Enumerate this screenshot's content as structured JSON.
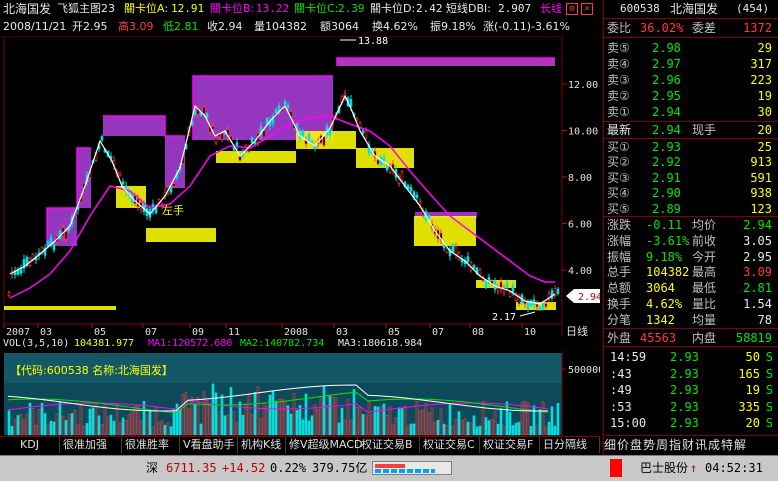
{
  "header": {
    "stock_name": "北海国发",
    "indicator_name": "飞狐主图23",
    "pass_a_label": "關卡位A:",
    "pass_a_value": "12.91",
    "pass_b_label": "關卡位B:",
    "pass_b_value": "13.22",
    "pass_c_label": "關卡位C:",
    "pass_c_value": "2.39",
    "pass_d_label": "關卡位D:",
    "pass_d_value": "2.42",
    "dbi_label": "短线DBI:",
    "dbi_value": "2.907",
    "trend_label": "长线"
  },
  "info_bar": {
    "date": "2008/11/21",
    "open": "开2.95",
    "high": "高3.09",
    "low": "低2.81",
    "close": "收2.94",
    "volume": "量104382",
    "amount": "额3064",
    "turnover": "换4.62%",
    "amplitude": "振9.18%",
    "change": "涨(-0.11)-3.61%"
  },
  "chart_labels": {
    "max_price": "13.88",
    "min_price": "2.17",
    "current_price": "2.94",
    "annotation": "左手",
    "y_ticks": [
      "12.00",
      "10.00",
      "8.00",
      "6.00",
      "4.00"
    ],
    "x_ticks": [
      "2007",
      "03",
      "05",
      "07",
      "09",
      "11",
      "2008",
      "03",
      "05",
      "07",
      "08",
      "10"
    ],
    "period": "日线"
  },
  "volume_panel": {
    "vol_label": "VOL(3,5,10)",
    "vol_value": "104381.977",
    "ma1": "MA1:120572.680",
    "ma2": "MA2:140782.734",
    "ma3": "MA3:180618.984",
    "code_label": "【代码:600538 名称:北海国发】",
    "y_tick": "500000"
  },
  "tabs": [
    "KDJ",
    "很准加强",
    "很准胜率",
    "V看盘助手",
    "机构K线",
    "修V超级MACD",
    "权证交易B",
    "权证交易C",
    "权证交易F",
    "日分隔线"
  ],
  "quote_panel": {
    "code": "600538",
    "name": "北海国发",
    "number": "(454)",
    "wei_bi_label": "委比",
    "wei_bi_value": "36.02%",
    "wei_cha_label": "委差",
    "wei_cha_value": "1372",
    "asks": [
      {
        "label": "卖⑤",
        "price": "2.98",
        "vol": "29"
      },
      {
        "label": "卖④",
        "price": "2.97",
        "vol": "317"
      },
      {
        "label": "卖③",
        "price": "2.96",
        "vol": "223"
      },
      {
        "label": "卖②",
        "price": "2.95",
        "vol": "19"
      },
      {
        "label": "卖①",
        "price": "2.94",
        "vol": "30"
      }
    ],
    "latest_label": "最新",
    "latest_value": "2.94",
    "hand_label": "现手",
    "hand_value": "20",
    "bids": [
      {
        "label": "买①",
        "price": "2.93",
        "vol": "25"
      },
      {
        "label": "买②",
        "price": "2.92",
        "vol": "913"
      },
      {
        "label": "买③",
        "price": "2.91",
        "vol": "591"
      },
      {
        "label": "买④",
        "price": "2.90",
        "vol": "938"
      },
      {
        "label": "买⑤",
        "price": "2.89",
        "vol": "123"
      }
    ],
    "stats": [
      {
        "l1": "涨跌",
        "v1": "-0.11",
        "l2": "均价",
        "v2": "2.94"
      },
      {
        "l1": "涨幅",
        "v1": "-3.61%",
        "l2": "前收",
        "v2": "3.05"
      },
      {
        "l1": "振幅",
        "v1": "9.18%",
        "l2": "今开",
        "v2": "2.95"
      },
      {
        "l1": "总手",
        "v1": "104382",
        "l2": "最高",
        "v2": "3.09"
      },
      {
        "l1": "总额",
        "v1": "3064",
        "l2": "最低",
        "v2": "2.81"
      },
      {
        "l1": "换手",
        "v1": "4.62%",
        "l2": "量比",
        "v2": "1.54"
      },
      {
        "l1": "分笔",
        "v1": "1342",
        "l2": "均量",
        "v2": "78"
      }
    ],
    "outer_label": "外盘",
    "outer_value": "45563",
    "inner_label": "内盘",
    "inner_value": "58819",
    "ticks": [
      {
        "time": "14:59",
        "price": "2.93",
        "vol": "50",
        "flag": "S"
      },
      {
        "time": ":43",
        "price": "2.93",
        "vol": "165",
        "flag": "S"
      },
      {
        "time": ":49",
        "price": "2.93",
        "vol": "19",
        "flag": "S"
      },
      {
        "time": ":53",
        "price": "2.93",
        "vol": "335",
        "flag": "S"
      },
      {
        "time": "15:00",
        "price": "2.93",
        "vol": "20",
        "flag": "S"
      }
    ],
    "bottom_tabs": "细价盘势周指财讯成特解"
  },
  "status_bar": {
    "index_name": "深",
    "index_value": "6711.35",
    "index_change": "+14.52",
    "index_pct": "0.22%",
    "index_amount": "379.75亿",
    "broker": "巴士股份",
    "broker_change": "↑",
    "clock": "04:52:31"
  },
  "colors": {
    "up_red": "#ff3c3c",
    "down_green": "#00e600",
    "resistance_purple": "#c040ff",
    "support_yellow": "#ffff00",
    "ma_magenta": "#ff00ff",
    "volume_bg": "#0c4a5a"
  }
}
